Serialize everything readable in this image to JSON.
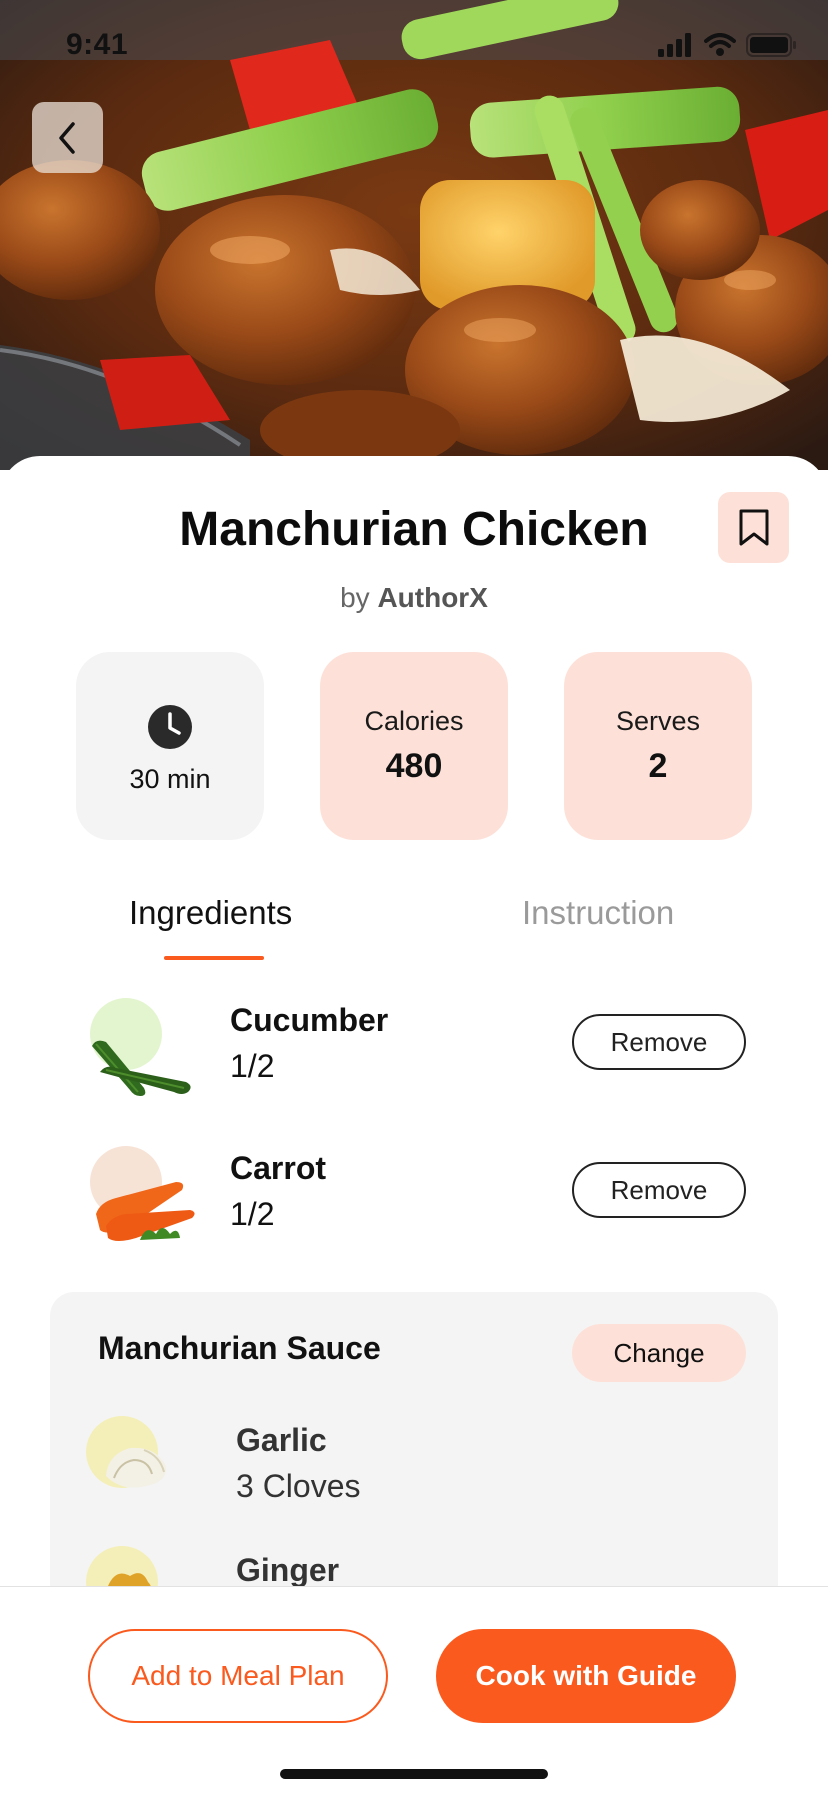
{
  "status_bar": {
    "time": "9:41"
  },
  "recipe": {
    "title": "Manchurian Chicken",
    "author_prefix": "by",
    "author_name": "AuthorX"
  },
  "stats": {
    "time_value": "30 min",
    "calories_label": "Calories",
    "calories_value": "480",
    "serves_label": "Serves",
    "serves_value": "2"
  },
  "tabs": [
    {
      "label": "Ingredients",
      "active": true
    },
    {
      "label": "Instruction",
      "active": false
    }
  ],
  "ingredients": [
    {
      "name": "Cucumber",
      "qty": "1/2",
      "action": "Remove",
      "icon": "cucumber-icon"
    },
    {
      "name": "Carrot",
      "qty": "1/2",
      "action": "Remove",
      "icon": "carrot-icon"
    }
  ],
  "sauce": {
    "title": "Manchurian Sauce",
    "change_label": "Change",
    "items": [
      {
        "name": "Garlic",
        "qty": "3 Cloves",
        "icon": "garlic-icon"
      },
      {
        "name": "Ginger",
        "qty": "",
        "icon": "ginger-icon"
      }
    ]
  },
  "actions": {
    "meal_plan_label": "Add to Meal Plan",
    "cook_label": "Cook with Guide"
  },
  "colors": {
    "accent": "#fa5a1e",
    "soft_accent": "#fde1d8",
    "card_gray": "#f4f4f4"
  }
}
